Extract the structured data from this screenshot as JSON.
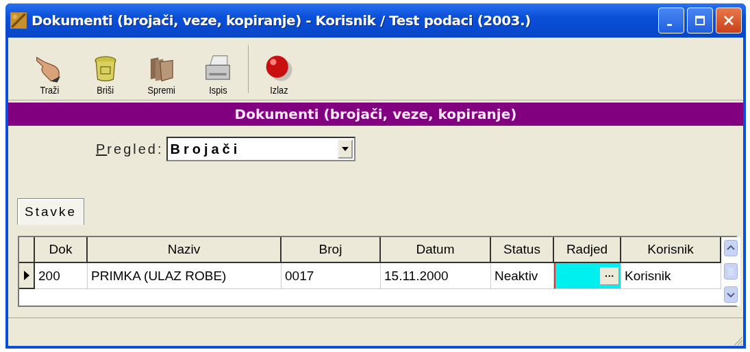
{
  "window": {
    "title": "Dokumenti (brojači, veze, kopiranje) - Korisnik / Test podaci (2003.)"
  },
  "toolbar": [
    {
      "label": "Traži",
      "kind": "hand"
    },
    {
      "label": "Briši",
      "kind": "bin"
    },
    {
      "label": "Spremi",
      "kind": "folders"
    },
    {
      "label": "Ispis",
      "kind": "printer"
    },
    {
      "label": "Izlaz",
      "kind": "ball"
    }
  ],
  "header_bar": {
    "title": "Dokumenti (brojači, veze, kopiranje)"
  },
  "view_select": {
    "label": "Pregled:",
    "mnemonic": true,
    "value": "Brojači"
  },
  "tabs": [
    {
      "label": "Stavke",
      "selected": true
    }
  ],
  "table": {
    "columns": [
      "Dok",
      "Naziv",
      "Broj",
      "Datum",
      "Status",
      "Radjed",
      "Korisnik"
    ],
    "rows": [
      {
        "current": true,
        "cells": [
          {
            "text": "200"
          },
          {
            "text": "PRIMKA (ULAZ ROBE)"
          },
          {
            "text": "0017"
          },
          {
            "text": "15.11.2000"
          },
          {
            "text": "Neaktiv"
          },
          {
            "kind": "lookup",
            "button": "···",
            "focused": true
          },
          {
            "text": "Korisnik"
          }
        ]
      }
    ]
  }
}
